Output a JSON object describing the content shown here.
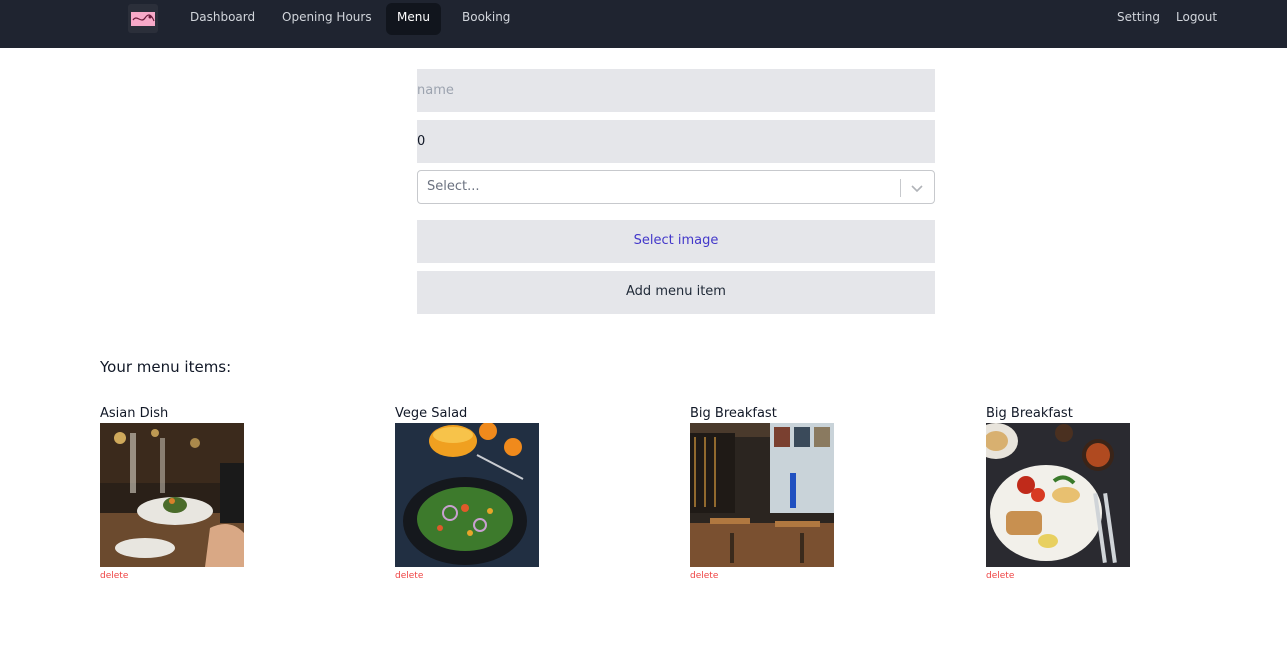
{
  "nav": {
    "logo_icon": "restaurant-logo",
    "links": [
      {
        "label": "Dashboard",
        "active": false
      },
      {
        "label": "Opening Hours",
        "active": false
      },
      {
        "label": "Menu",
        "active": true
      },
      {
        "label": "Booking",
        "active": false
      }
    ],
    "right_links": [
      {
        "label": "Setting"
      },
      {
        "label": "Logout"
      }
    ],
    "background_color": "#1f2430"
  },
  "form": {
    "name_field": {
      "placeholder": "name",
      "value": ""
    },
    "price_field": {
      "value": "0"
    },
    "category_select": {
      "placeholder": "Select...",
      "icon": "chevron-down-icon"
    },
    "select_image_label": "Select image",
    "add_item_label": "Add menu item"
  },
  "menu_section": {
    "heading": "Your menu items:",
    "items": [
      {
        "name": "Asian Dish",
        "image": "dish-photo-restaurant-table",
        "delete_label": "delete"
      },
      {
        "name": "Vege Salad",
        "image": "dish-photo-salad-bowl",
        "delete_label": "delete"
      },
      {
        "name": "Big Breakfast",
        "image": "photo-cafe-interior",
        "delete_label": "delete"
      },
      {
        "name": "Big Breakfast",
        "image": "dish-photo-breakfast-plate",
        "delete_label": "delete"
      }
    ]
  },
  "colors": {
    "accent_link": "#4338ca",
    "delete": "#ef4444",
    "field_background": "#e5e6ea"
  }
}
